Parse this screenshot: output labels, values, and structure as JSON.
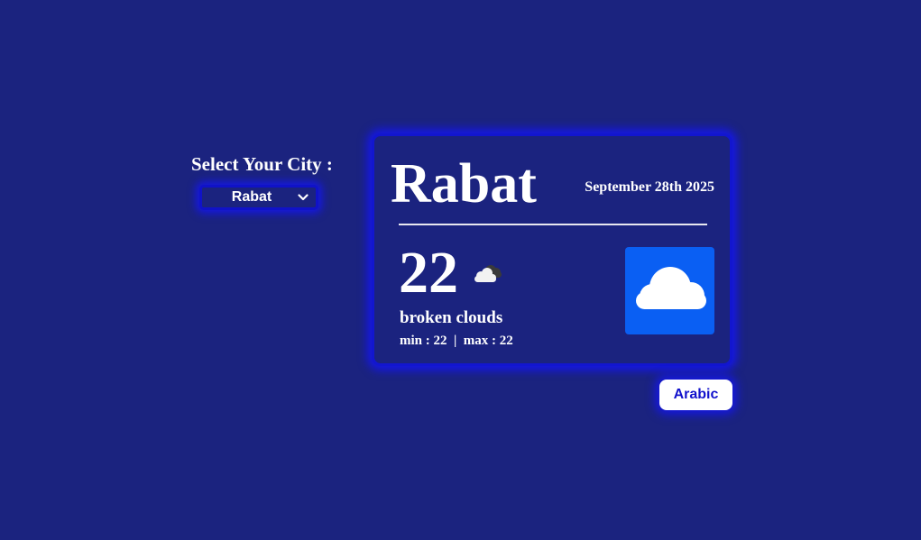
{
  "city_selector": {
    "label": "Select Your City :",
    "selected": "Rabat"
  },
  "weather_card": {
    "city": "Rabat",
    "date": "September 28th 2025",
    "temperature": "22",
    "description": "broken clouds",
    "min_max": "min : 22  |  max : 22",
    "small_icon": "cloud-icon",
    "large_icon": "cloud-icon"
  },
  "language_button": {
    "label": "Arabic"
  },
  "colors": {
    "background": "#1b237f",
    "accent_glow": "#1216cf",
    "icon_tile": "#0a5ff3",
    "button_text": "#1212cc"
  }
}
